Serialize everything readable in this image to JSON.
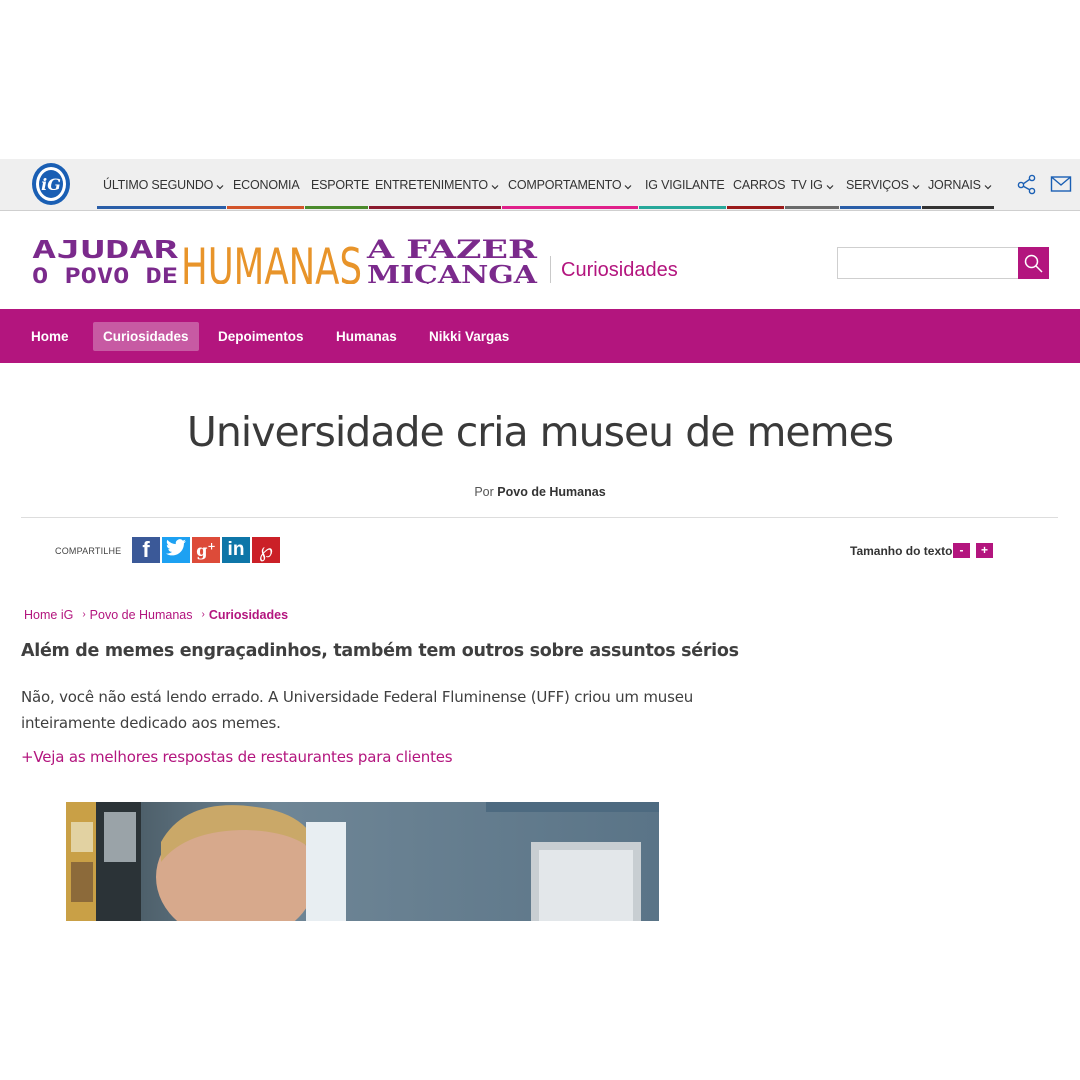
{
  "topbar": {
    "logo_text": "iG",
    "nav": [
      {
        "label": "ÚLTIMO SEGUNDO",
        "dropdown": true,
        "color": "#2a5ea8"
      },
      {
        "label": "ECONOMIA",
        "dropdown": false,
        "color": "#d2542a"
      },
      {
        "label": "ESPORTE",
        "dropdown": false,
        "color": "#4a8a2b"
      },
      {
        "label": "ENTRETENIMENTO",
        "dropdown": true,
        "color": "#8a1a2e"
      },
      {
        "label": "COMPORTAMENTO",
        "dropdown": true,
        "color": "#e0208a"
      },
      {
        "label": "IG VIGILANTE",
        "dropdown": false,
        "color": "#27a89a"
      },
      {
        "label": "CARROS",
        "dropdown": false,
        "color": "#9a1a1a"
      },
      {
        "label": "TV IG",
        "dropdown": true,
        "color": "#6a6a6a"
      },
      {
        "label": "SERVIÇOS",
        "dropdown": true,
        "color": "#2a5ea8"
      },
      {
        "label": "JORNAIS",
        "dropdown": true,
        "color": "#333333"
      }
    ],
    "icons": [
      "share-icon",
      "mail-icon"
    ]
  },
  "brand": {
    "logo_line1_left": "AJUDAR",
    "logo_line2_left": "O POVO DE",
    "logo_center": "HUMANAS",
    "logo_line1_right": "A FAZER",
    "logo_line2_right": "MIÇANGA",
    "section": "Curiosidades",
    "search_value": ""
  },
  "secnav": {
    "items": [
      "Home",
      "Curiosidades",
      "Depoimentos",
      "Humanas",
      "Nikki Vargas"
    ],
    "active": "Curiosidades"
  },
  "article": {
    "headline": "Universidade cria museu de memes",
    "byline_prefix": "Por",
    "byline_author": "Povo de Humanas",
    "share_label": "COMPARTILHE",
    "share_networks": [
      "facebook",
      "twitter",
      "google-plus",
      "linkedin",
      "pinterest"
    ],
    "textsize_label": "Tamanho do texto",
    "textsize_minus": "-",
    "textsize_plus": "+",
    "breadcrumb": [
      "Home iG",
      "Povo de Humanas",
      "Curiosidades"
    ],
    "subtitle": "Além de memes engraçadinhos, também tem outros sobre assuntos sérios",
    "paragraph": "Não, você não está lendo errado. A Universidade Federal Fluminense (UFF) criou um museu inteiramente dedicado aos memes.",
    "related_link": "+Veja as melhores respostas de restaurantes para clientes"
  },
  "colors": {
    "brand_magenta": "#b3157e",
    "logo_purple": "#7b2a8c",
    "logo_orange": "#e8942a",
    "topbar_bg": "#efefef"
  }
}
